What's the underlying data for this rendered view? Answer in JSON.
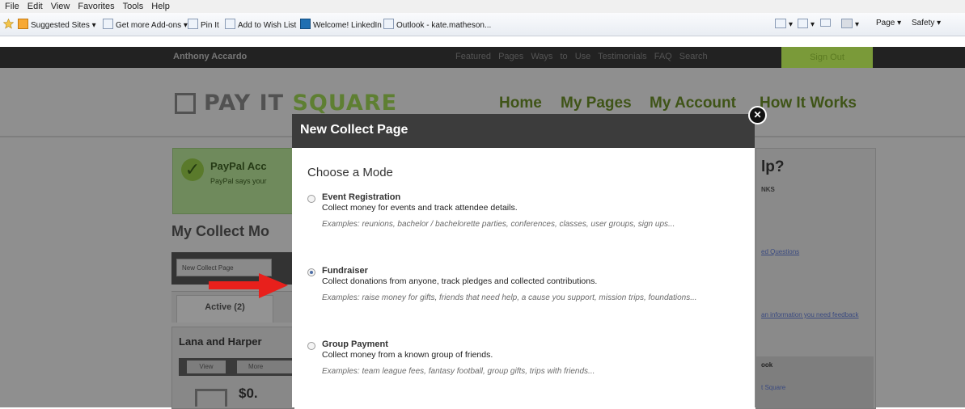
{
  "browser": {
    "menu": [
      "File",
      "Edit",
      "View",
      "Favorites",
      "Tools",
      "Help"
    ],
    "favorites": [
      "Suggested Sites ▾",
      "Get more Add-ons ▾",
      "Pin It",
      "Add to Wish List",
      "Welcome! LinkedIn",
      "Outlook - kate.matheson..."
    ],
    "commands": [
      "▾",
      "▾",
      "▾",
      "Page ▾",
      "Safety ▾"
    ]
  },
  "site": {
    "user": "Anthony Accardo",
    "top_links": "Featured Pages   Ways to Use   Testimonials   FAQ   Search",
    "signout": "Sign Out",
    "logo_text": "PAY IT ",
    "logo_accent": "SQUARE",
    "nav": [
      "Home",
      "My Pages",
      "My Account",
      "How It Works"
    ],
    "paypal_title": "PayPal Acc",
    "paypal_sub": "PayPal says your",
    "my_collect": "My Collect Mo",
    "new_collect_btn": "New Collect Page",
    "active_tab": "Active (2)",
    "card_title": "Lana and Harper",
    "view_btn": "View",
    "more_btn": "More",
    "amount": "$0.",
    "help_title": "lp?",
    "help_links": "NKS",
    "help_link1": "ed Questions",
    "help_link2": "an information you need\nfeedback",
    "sub_head": "ook",
    "sub_link": "t Square"
  },
  "modal": {
    "title": "New Collect Page",
    "heading": "Choose a Mode",
    "options": [
      {
        "label": "Event Registration",
        "desc": "Collect money for events and track attendee details.",
        "examples": "Examples: reunions, bachelor / bachelorette parties, conferences, classes, user groups, sign ups...",
        "checked": false
      },
      {
        "label": "Fundraiser",
        "desc": "Collect donations from anyone, track pledges and collected contributions.",
        "examples": "Examples: raise money for gifts, friends that need help, a cause you support, mission trips, foundations...",
        "checked": true
      },
      {
        "label": "Group Payment",
        "desc": "Collect money from a known group of friends.",
        "examples": "Examples: team league fees, fantasy football, group gifts, trips with friends...",
        "checked": false
      }
    ]
  },
  "colors": {
    "arrow": "#e8201c",
    "overlay": "#8f8f8f",
    "modal_header": "#3c3c3c"
  }
}
